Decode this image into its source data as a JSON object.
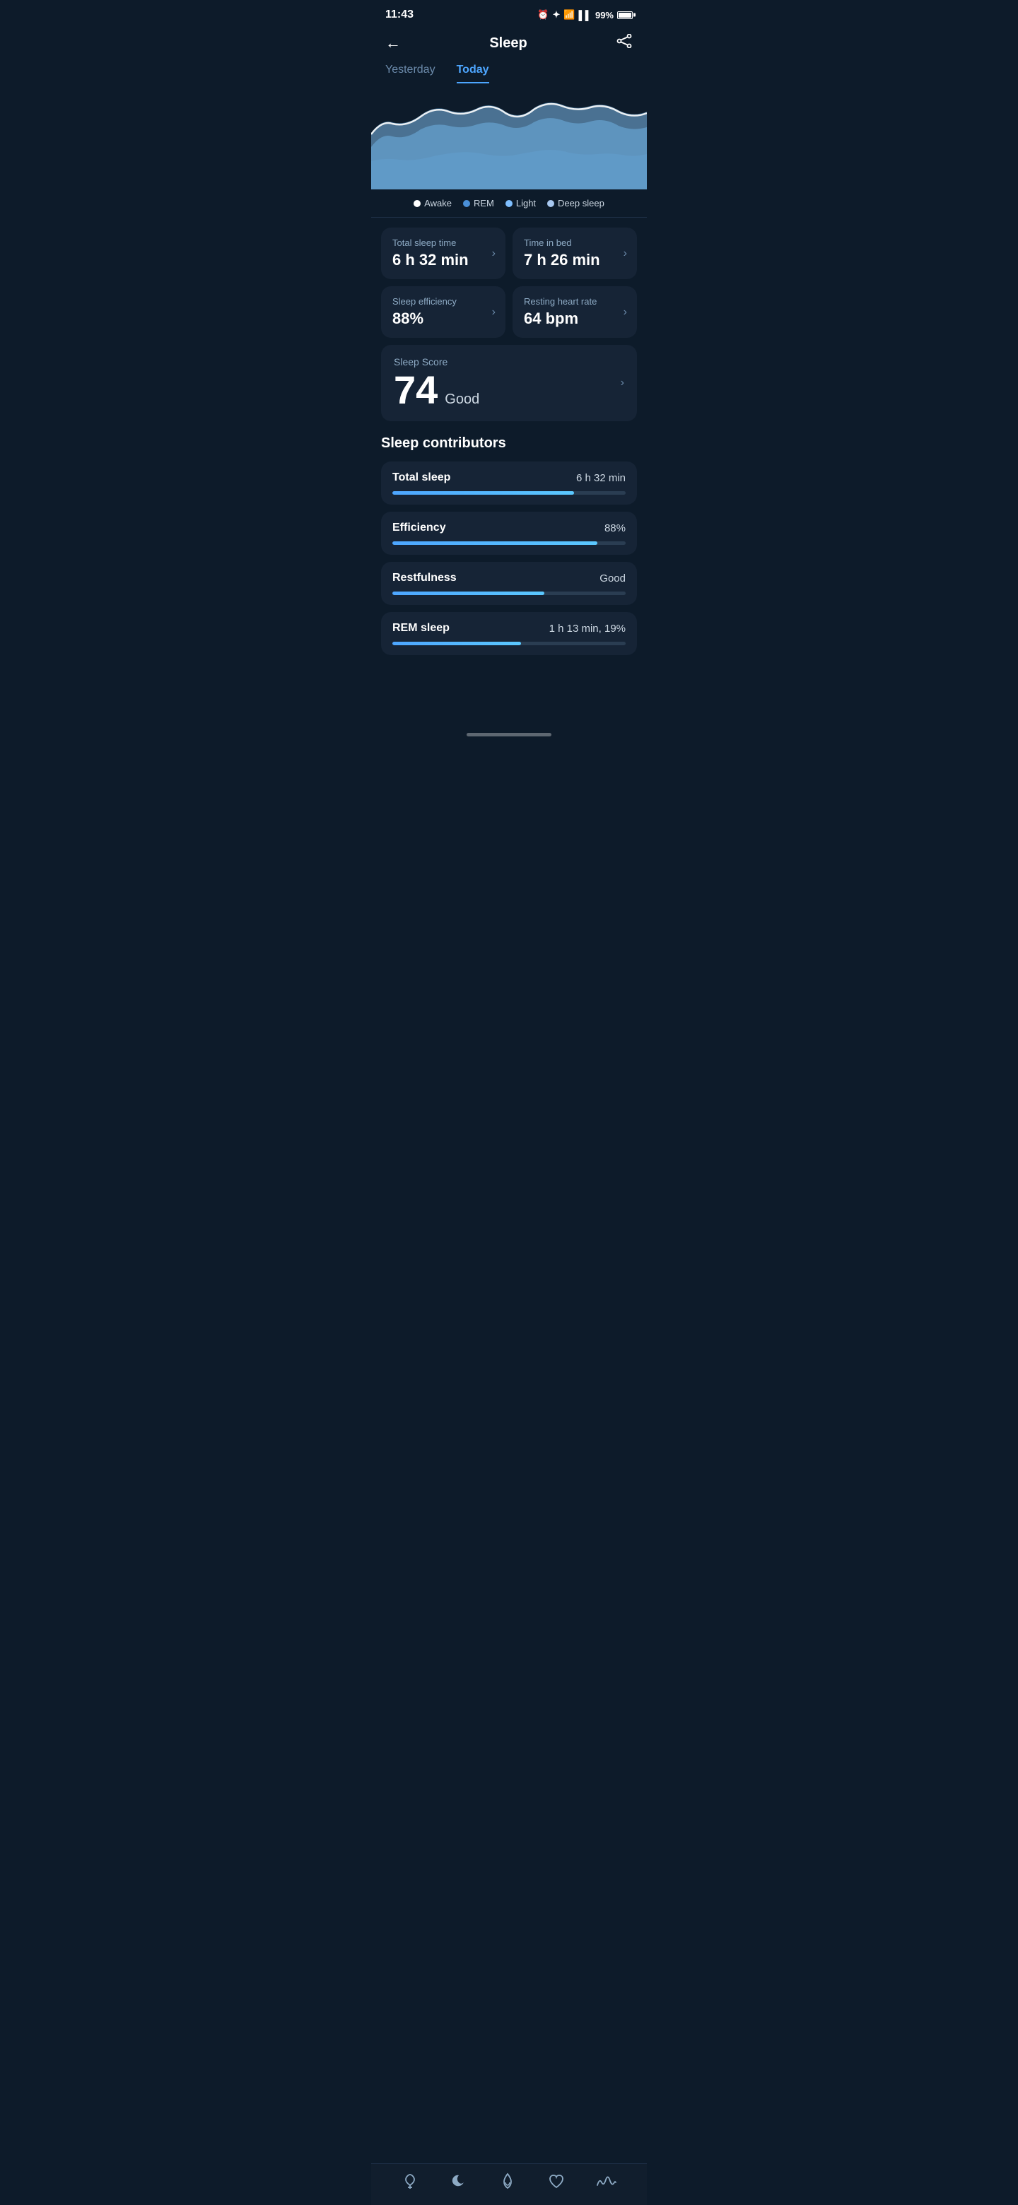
{
  "statusBar": {
    "time": "11:43",
    "battery": "99%"
  },
  "header": {
    "back_label": "←",
    "title": "Sleep",
    "share_label": "⬡"
  },
  "tabs": [
    {
      "label": "Yesterday",
      "active": false
    },
    {
      "label": "Today",
      "active": true
    }
  ],
  "legend": [
    {
      "label": "Awake",
      "color": "#ffffff"
    },
    {
      "label": "REM",
      "color": "#4a90d9"
    },
    {
      "label": "Light",
      "color": "#7fbfff"
    },
    {
      "label": "Deep sleep",
      "color": "#a8c8f0"
    }
  ],
  "stats": [
    {
      "label": "Total sleep time",
      "value": "6 h 32 min"
    },
    {
      "label": "Time in bed",
      "value": "7 h 26 min"
    },
    {
      "label": "Sleep efficiency",
      "value": "88%"
    },
    {
      "label": "Resting heart rate",
      "value": "64 bpm"
    }
  ],
  "sleepScore": {
    "label": "Sleep Score",
    "number": "74",
    "qualifier": "Good"
  },
  "contributors": {
    "title": "Sleep contributors",
    "items": [
      {
        "name": "Total sleep",
        "value": "6 h 32 min",
        "percent": 78
      },
      {
        "name": "Efficiency",
        "value": "88%",
        "percent": 88
      },
      {
        "name": "Restfulness",
        "value": "Good",
        "percent": 65
      },
      {
        "name": "REM sleep",
        "value": "1 h 13 min, 19%",
        "percent": 55
      }
    ]
  },
  "bottomNav": [
    {
      "icon": "🌱",
      "name": "activity-nav"
    },
    {
      "icon": "🌙",
      "name": "sleep-nav"
    },
    {
      "icon": "🔥",
      "name": "calories-nav"
    },
    {
      "icon": "♡",
      "name": "heart-nav"
    },
    {
      "icon": "〰",
      "name": "stress-nav"
    }
  ]
}
